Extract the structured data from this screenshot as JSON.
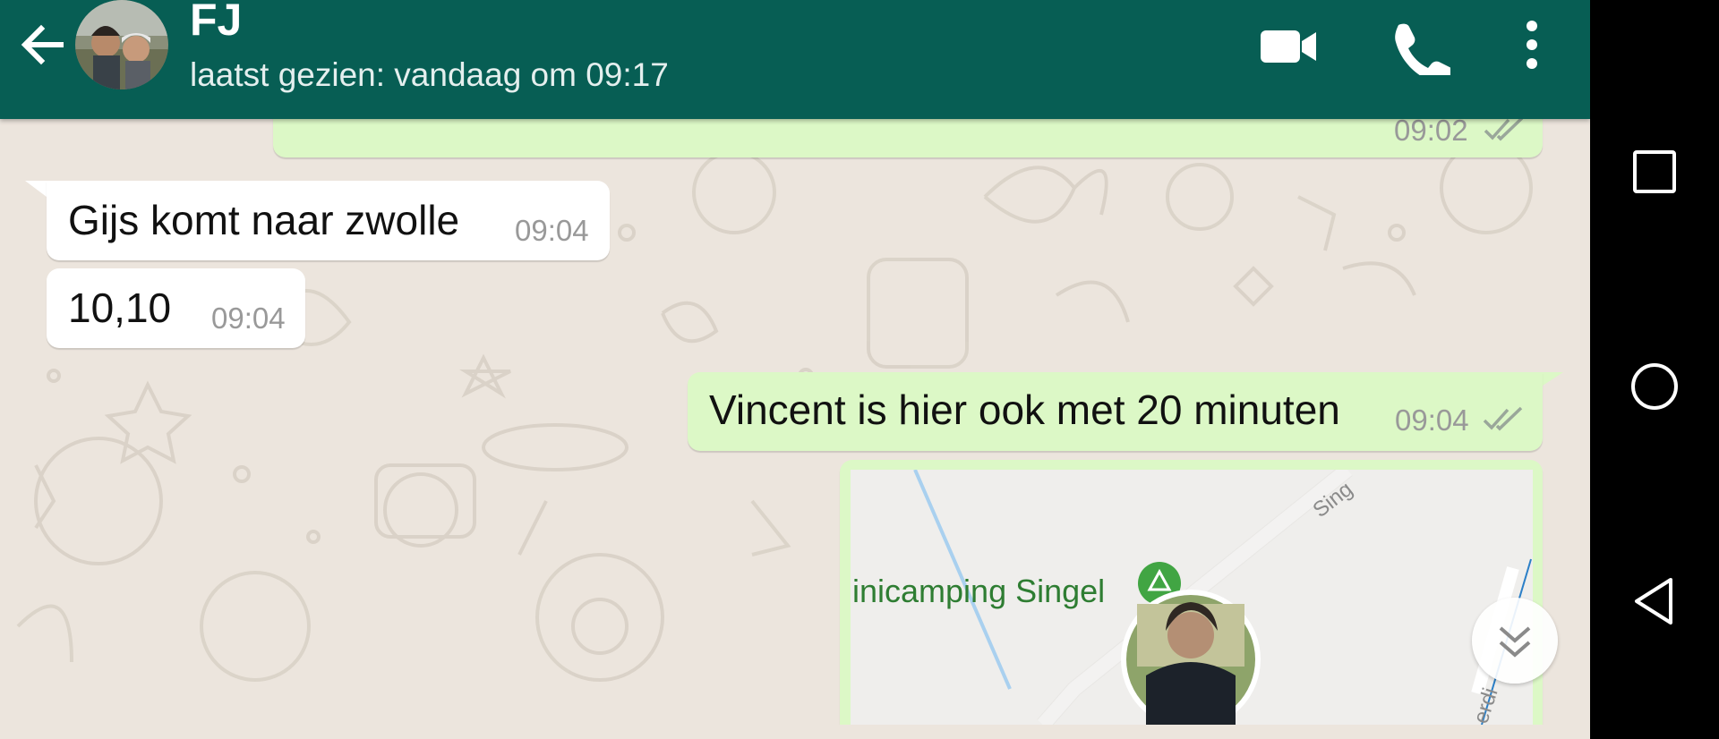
{
  "header": {
    "contact_name": "FJ",
    "last_seen": "laatst gezien: vandaag om 09:17",
    "icons": [
      "back-arrow-icon",
      "video-call-icon",
      "phone-call-icon",
      "more-options-icon"
    ]
  },
  "messages": [
    {
      "direction": "outgoing",
      "text": "",
      "time": "09:02",
      "status": "read"
    },
    {
      "direction": "incoming",
      "text": "Gijs komt naar zwolle",
      "time": "09:04"
    },
    {
      "direction": "incoming",
      "text": "10,10",
      "time": "09:04"
    },
    {
      "direction": "outgoing",
      "text": "Vincent is hier ook met 20 minuten",
      "time": "09:04",
      "status": "read"
    }
  ],
  "location_message": {
    "place_label": "inicamping Singel",
    "road_labels": [
      "Sing",
      "erdi"
    ]
  },
  "colors": {
    "header": "#075e54",
    "outgoing_bubble": "#dcf8c6",
    "incoming_bubble": "#ffffff",
    "chat_background": "#ece5dd",
    "read_ticks": "#9aa79a",
    "map_label": "#2e7d32"
  },
  "system_nav": [
    "recents-square-icon",
    "home-circle-icon",
    "back-triangle-icon"
  ]
}
